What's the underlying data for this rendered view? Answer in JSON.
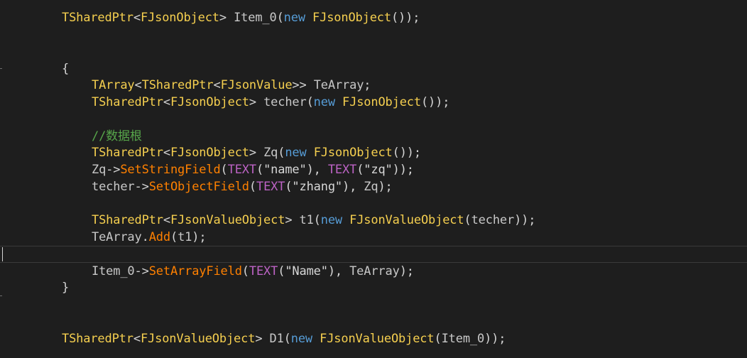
{
  "editor": {
    "colors": {
      "background": "#1e1e1e",
      "type": "#f5cf4f",
      "keyword": "#569cd6",
      "function": "#ff8000",
      "macro": "#bd63c5",
      "comment": "#57a64a",
      "text": "#dcdcdc"
    },
    "lines": [
      {
        "indent": 0,
        "tokens": [
          {
            "t": "TSharedPtr",
            "c": "type"
          },
          {
            "t": "<",
            "c": "punc"
          },
          {
            "t": "FJsonObject",
            "c": "type"
          },
          {
            "t": "> ",
            "c": "punc"
          },
          {
            "t": "Item_0",
            "c": "var"
          },
          {
            "t": "(",
            "c": "punc"
          },
          {
            "t": "new",
            "c": "kw"
          },
          {
            "t": " ",
            "c": "punc"
          },
          {
            "t": "FJsonObject",
            "c": "type"
          },
          {
            "t": "());",
            "c": "punc"
          }
        ]
      },
      {
        "indent": 0,
        "tokens": [
          {
            "t": "{",
            "c": "punc"
          }
        ]
      },
      {
        "indent": 1,
        "tokens": [
          {
            "t": "TArray",
            "c": "type"
          },
          {
            "t": "<",
            "c": "punc"
          },
          {
            "t": "TSharedPtr",
            "c": "type"
          },
          {
            "t": "<",
            "c": "punc"
          },
          {
            "t": "FJsonValue",
            "c": "type"
          },
          {
            "t": ">> ",
            "c": "punc"
          },
          {
            "t": "TeArray",
            "c": "var"
          },
          {
            "t": ";",
            "c": "punc"
          }
        ]
      },
      {
        "indent": 1,
        "tokens": [
          {
            "t": "TSharedPtr",
            "c": "type"
          },
          {
            "t": "<",
            "c": "punc"
          },
          {
            "t": "FJsonObject",
            "c": "type"
          },
          {
            "t": "> ",
            "c": "punc"
          },
          {
            "t": "techer",
            "c": "var"
          },
          {
            "t": "(",
            "c": "punc"
          },
          {
            "t": "new",
            "c": "kw"
          },
          {
            "t": " ",
            "c": "punc"
          },
          {
            "t": "FJsonObject",
            "c": "type"
          },
          {
            "t": "());",
            "c": "punc"
          }
        ]
      },
      {
        "indent": 1,
        "tokens": [
          {
            "t": "//数据根",
            "c": "cmt"
          }
        ]
      },
      {
        "indent": 1,
        "tokens": [
          {
            "t": "TSharedPtr",
            "c": "type"
          },
          {
            "t": "<",
            "c": "punc"
          },
          {
            "t": "FJsonObject",
            "c": "type"
          },
          {
            "t": "> ",
            "c": "punc"
          },
          {
            "t": "Zq",
            "c": "var"
          },
          {
            "t": "(",
            "c": "punc"
          },
          {
            "t": "new",
            "c": "kw"
          },
          {
            "t": " ",
            "c": "punc"
          },
          {
            "t": "FJsonObject",
            "c": "type"
          },
          {
            "t": "());",
            "c": "punc"
          }
        ]
      },
      {
        "indent": 1,
        "tokens": [
          {
            "t": "Zq",
            "c": "var"
          },
          {
            "t": "->",
            "c": "punc"
          },
          {
            "t": "SetStringField",
            "c": "func"
          },
          {
            "t": "(",
            "c": "punc"
          },
          {
            "t": "TEXT",
            "c": "macro"
          },
          {
            "t": "(\"name\"), ",
            "c": "str"
          },
          {
            "t": "TEXT",
            "c": "macro"
          },
          {
            "t": "(\"zq\"));",
            "c": "str"
          }
        ]
      },
      {
        "indent": 1,
        "tokens": [
          {
            "t": "techer",
            "c": "var"
          },
          {
            "t": "->",
            "c": "punc"
          },
          {
            "t": "SetObjectField",
            "c": "func"
          },
          {
            "t": "(",
            "c": "punc"
          },
          {
            "t": "TEXT",
            "c": "macro"
          },
          {
            "t": "(\"zhang\"), ",
            "c": "str"
          },
          {
            "t": "Zq",
            "c": "var"
          },
          {
            "t": ");",
            "c": "punc"
          }
        ]
      },
      {
        "indent": 1,
        "tokens": [
          {
            "t": "TSharedPtr",
            "c": "type"
          },
          {
            "t": "<",
            "c": "punc"
          },
          {
            "t": "FJsonValueObject",
            "c": "type"
          },
          {
            "t": "> ",
            "c": "punc"
          },
          {
            "t": "t1",
            "c": "var"
          },
          {
            "t": "(",
            "c": "punc"
          },
          {
            "t": "new",
            "c": "kw"
          },
          {
            "t": " ",
            "c": "punc"
          },
          {
            "t": "FJsonValueObject",
            "c": "type"
          },
          {
            "t": "(",
            "c": "punc"
          },
          {
            "t": "techer",
            "c": "var"
          },
          {
            "t": "));",
            "c": "punc"
          }
        ]
      },
      {
        "indent": 1,
        "tokens": [
          {
            "t": "TeArray",
            "c": "var"
          },
          {
            "t": ".",
            "c": "punc"
          },
          {
            "t": "Add",
            "c": "func"
          },
          {
            "t": "(",
            "c": "punc"
          },
          {
            "t": "t1",
            "c": "var"
          },
          {
            "t": ");",
            "c": "punc"
          }
        ]
      },
      {
        "indent": 1,
        "tokens": [
          {
            "t": "Item_0",
            "c": "var"
          },
          {
            "t": "->",
            "c": "punc"
          },
          {
            "t": "SetArrayField",
            "c": "func"
          },
          {
            "t": "(",
            "c": "punc"
          },
          {
            "t": "TEXT",
            "c": "macro"
          },
          {
            "t": "(\"Name\"), ",
            "c": "str"
          },
          {
            "t": "TeArray",
            "c": "var"
          },
          {
            "t": ");",
            "c": "punc"
          }
        ]
      },
      {
        "indent": 0,
        "tokens": [
          {
            "t": "}",
            "c": "punc"
          }
        ]
      },
      {
        "indent": 0,
        "tokens": [
          {
            "t": "TSharedPtr",
            "c": "type"
          },
          {
            "t": "<",
            "c": "punc"
          },
          {
            "t": "FJsonValueObject",
            "c": "type"
          },
          {
            "t": "> ",
            "c": "punc"
          },
          {
            "t": "D1",
            "c": "var"
          },
          {
            "t": "(",
            "c": "punc"
          },
          {
            "t": "new",
            "c": "kw"
          },
          {
            "t": " ",
            "c": "punc"
          },
          {
            "t": "FJsonValueObject",
            "c": "type"
          },
          {
            "t": "(",
            "c": "punc"
          },
          {
            "t": "Item_0",
            "c": "var"
          },
          {
            "t": "));",
            "c": "punc"
          }
        ]
      }
    ]
  }
}
